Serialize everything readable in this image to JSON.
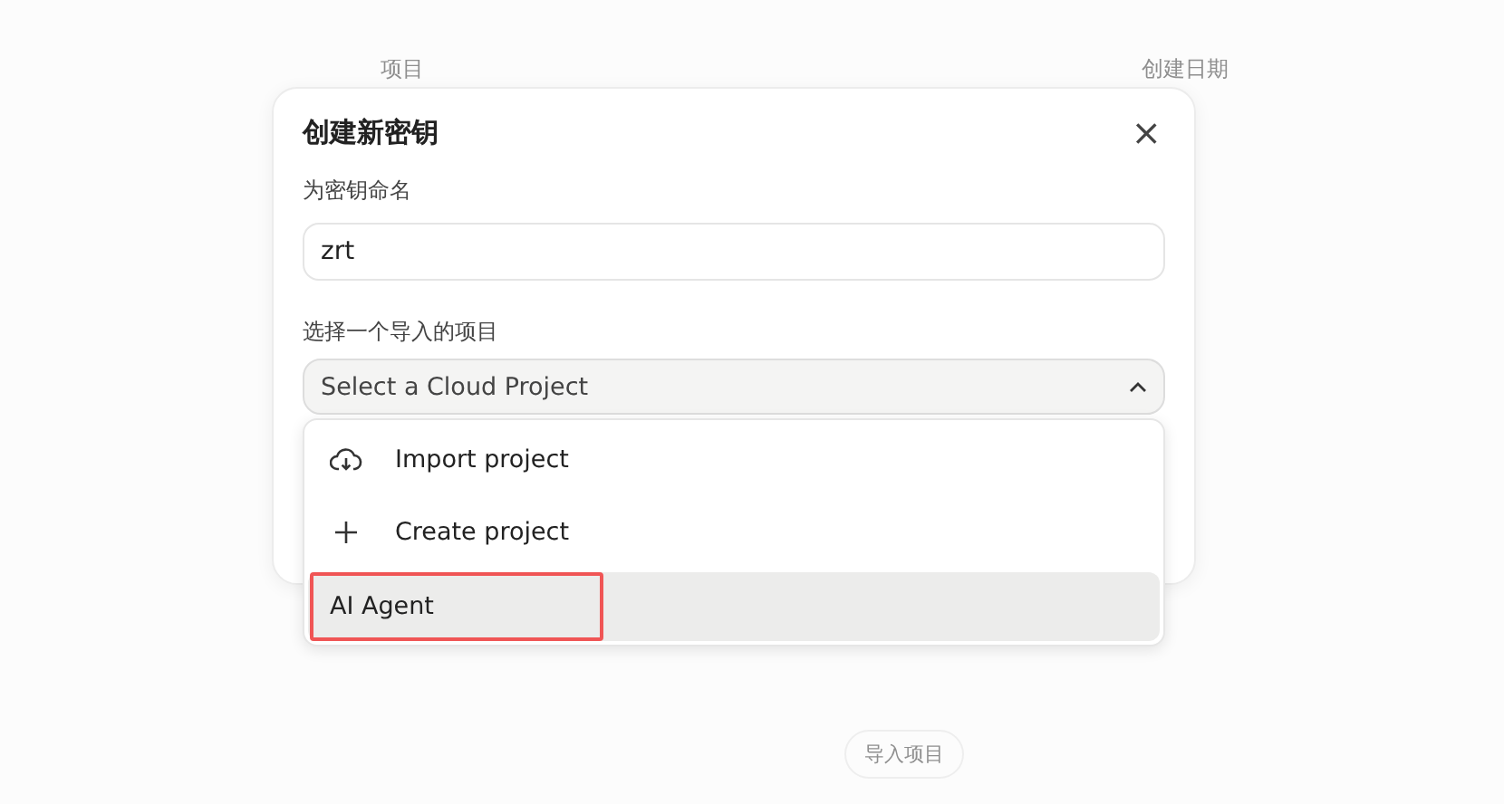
{
  "background": {
    "columns": [
      "项目",
      "创建日期"
    ],
    "button": "导入项目"
  },
  "dialog": {
    "title": "创建新密钥",
    "close": "×",
    "name_label": "为密钥命名",
    "name_value": "zrt",
    "project_label": "选择一个导入的项目",
    "select_placeholder": "Select a Cloud Project",
    "expanded": true,
    "options": [
      {
        "kind": "import",
        "label": "Import project",
        "selected": false,
        "highlighted": false
      },
      {
        "kind": "create",
        "label": "Create project",
        "selected": false,
        "highlighted": false
      },
      {
        "kind": "project",
        "label": "AI Agent",
        "selected": true,
        "highlighted": true
      }
    ]
  }
}
